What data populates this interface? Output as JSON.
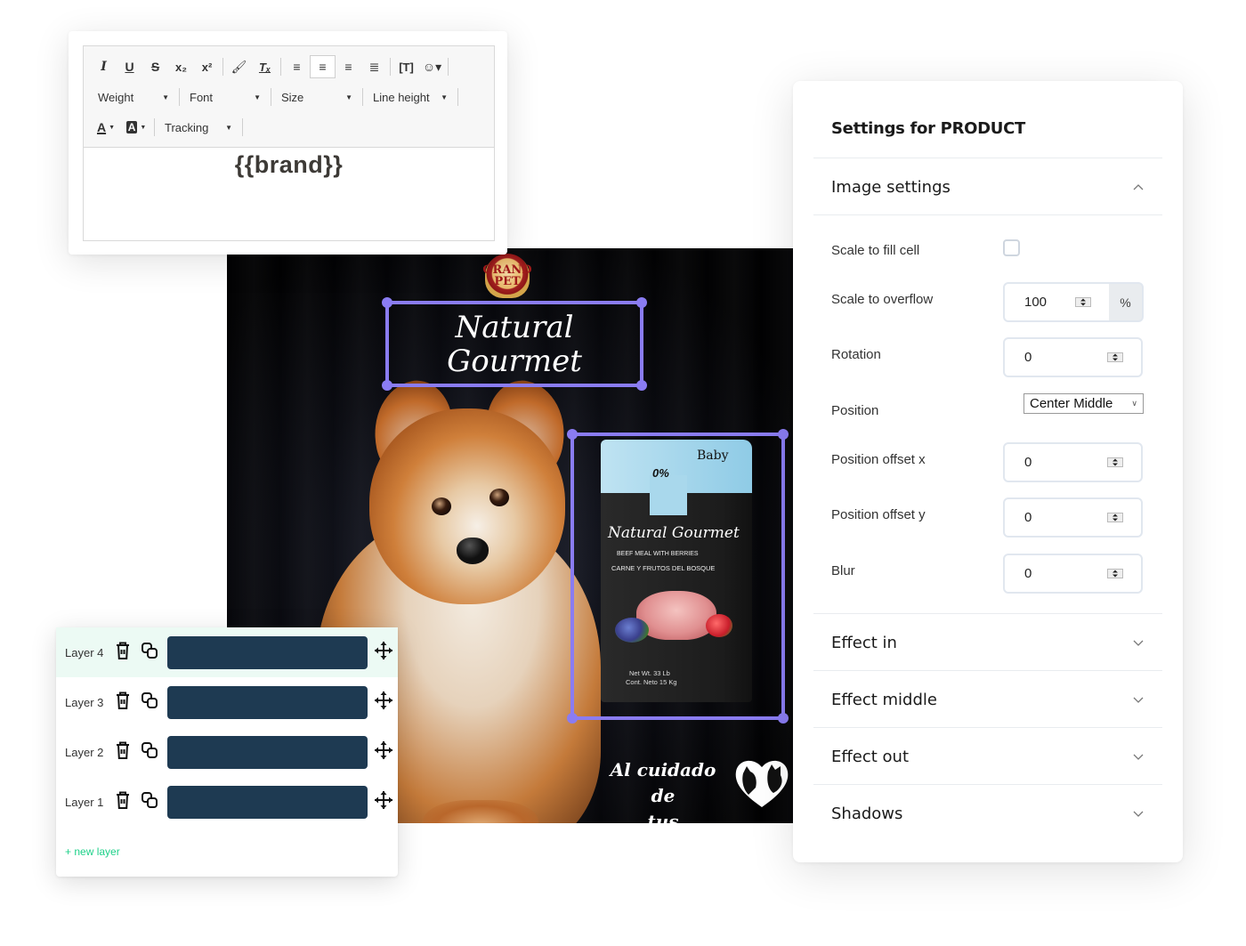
{
  "editor": {
    "toolbar_row1": [
      {
        "name": "italic-button",
        "icon": "italic-icon",
        "glyph": "I"
      },
      {
        "name": "underline-button",
        "icon": "underline-icon",
        "glyph": "U"
      },
      {
        "name": "strikethrough-button",
        "icon": "strikethrough-icon",
        "glyph": "S"
      },
      {
        "name": "subscript-button",
        "icon": "subscript-icon",
        "glyph": "x₂"
      },
      {
        "name": "superscript-button",
        "icon": "superscript-icon",
        "glyph": "x²"
      },
      {
        "name": "format-painter-button",
        "icon": "paint-brush-icon",
        "glyph": "🖌"
      },
      {
        "name": "clear-formatting-button",
        "icon": "clear-format-icon",
        "glyph": "Tₓ"
      },
      {
        "name": "align-left-button",
        "icon": "align-left-icon",
        "glyph": "≡"
      },
      {
        "name": "align-center-button",
        "icon": "align-center-icon",
        "glyph": "≡",
        "active": true
      },
      {
        "name": "align-right-button",
        "icon": "align-right-icon",
        "glyph": "≡"
      },
      {
        "name": "justify-button",
        "icon": "align-justify-icon",
        "glyph": "≣"
      },
      {
        "name": "insert-text-field-button",
        "icon": "text-field-icon",
        "glyph": "[T]"
      },
      {
        "name": "emoji-button",
        "icon": "emoji-icon",
        "glyph": "☺▾"
      }
    ],
    "selects_row2": {
      "weight": "Weight",
      "font": "Font",
      "size": "Size",
      "line_height": "Line height"
    },
    "row3": {
      "text_color_glyph": "A",
      "bg_color_glyph": "A",
      "tracking": "Tracking"
    },
    "content": "{{brand}}"
  },
  "canvas": {
    "logo_text": "GRAND PET",
    "headline_line1": "Natural",
    "headline_line2": "Gourmet",
    "product": {
      "badge": "0%",
      "variant": "Baby",
      "brand": "Natural Gourmet",
      "line1": "BEEF MEAL WITH BERRIES",
      "line2": "CARNE Y FRUTOS DEL BOSQUE",
      "net1": "Net Wt. 33 Lb",
      "net2": "Cont. Neto 15 Kg"
    },
    "tagline_line1": "Al cuidado de",
    "tagline_line2": "tus cachorros",
    "selection_color": "#8a7cf2"
  },
  "layers": {
    "items": [
      {
        "label": "Layer 4",
        "active": true
      },
      {
        "label": "Layer 3",
        "active": false
      },
      {
        "label": "Layer 2",
        "active": false
      },
      {
        "label": "Layer 1",
        "active": false
      }
    ],
    "new_layer_label": "+ new layer",
    "bar_color": "#1e3a52",
    "accent_color": "#1fd18a"
  },
  "settings": {
    "title": "Settings for PRODUCT",
    "image_settings": {
      "title": "Image settings",
      "expanded": true,
      "scale_to_fill_label": "Scale to fill cell",
      "scale_to_fill_checked": false,
      "scale_to_overflow_label": "Scale to overflow",
      "scale_to_overflow_value": "100",
      "scale_to_overflow_unit": "%",
      "rotation_label": "Rotation",
      "rotation_value": "0",
      "position_label": "Position",
      "position_value": "Center Middle",
      "offset_x_label": "Position offset x",
      "offset_x_value": "0",
      "offset_y_label": "Position offset y",
      "offset_y_value": "0",
      "blur_label": "Blur",
      "blur_value": "0"
    },
    "sections": [
      {
        "title": "Effect in"
      },
      {
        "title": "Effect middle"
      },
      {
        "title": "Effect out"
      },
      {
        "title": "Shadows"
      }
    ]
  }
}
